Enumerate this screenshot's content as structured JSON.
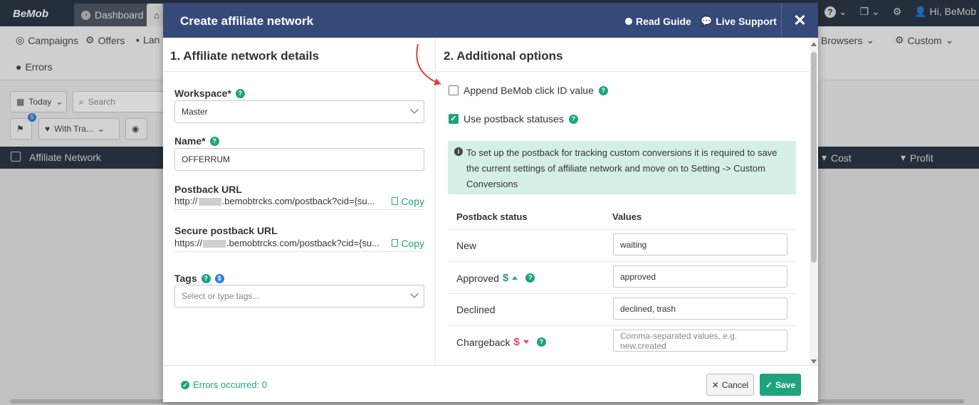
{
  "app": {
    "logo": "BeMob",
    "top_tabs": [
      "Dashboard",
      ""
    ],
    "user_greeting": "Hi, BeMob"
  },
  "nav": {
    "items": [
      "Campaigns",
      "Offers",
      "Lan",
      "Browsers",
      "Custom",
      "Errors"
    ]
  },
  "toolbar": {
    "date_filter": "Today",
    "search_placeholder": "Search",
    "group_filter": "With Tra...",
    "badge_count": "5"
  },
  "table": {
    "headers": [
      "Affiliate Network",
      "Cost",
      "Profit"
    ]
  },
  "modal": {
    "title": "Create affiliate network",
    "read_guide": "Read Guide",
    "live_support": "Live Support",
    "close_symbol": "✕",
    "left": {
      "section_title": "1. Affiliate network details",
      "workspace_label": "Workspace*",
      "workspace_value": "Master",
      "name_label": "Name*",
      "name_value": "OFFERRUM",
      "postback_label": "Postback URL",
      "postback_prefix": "http://",
      "postback_suffix": ".bemobtrcks.com/postback?cid={su...",
      "secure_postback_label": "Secure postback URL",
      "secure_postback_prefix": "https://",
      "secure_postback_suffix": ".bemobtrcks.com/postback?cid={su...",
      "copy_label": "Copy",
      "tags_label": "Tags",
      "tags_placeholder": "Select or type tags..."
    },
    "right": {
      "section_title": "2. Additional options",
      "append_click_id_label": "Append BeMob click ID value",
      "append_click_id_checked": false,
      "use_postback_statuses_label": "Use postback statuses",
      "use_postback_statuses_checked": true,
      "info_text": "To set up the postback for tracking custom conversions it is required to save the current settings of affiliate network and move on to Setting -> Custom Conversions",
      "col_status": "Postback status",
      "col_values": "Values",
      "rows": [
        {
          "status": "New",
          "value": "waiting",
          "placeholder": ""
        },
        {
          "status": "Approved",
          "value": "approved",
          "placeholder": ""
        },
        {
          "status": "Declined",
          "value": "declined, trash",
          "placeholder": ""
        },
        {
          "status": "Chargeback",
          "value": "",
          "placeholder": "Comma-separated values, e.g. new,created"
        }
      ]
    },
    "footer": {
      "errors_text": "Errors occurred: 0",
      "cancel_label": "Cancel",
      "save_label": "Save"
    }
  },
  "colors": {
    "header_bg": "#364a7a",
    "accent_green": "#1fa37f",
    "topbar_bg": "#253140",
    "info_bg": "#d6efe6",
    "danger_red": "#e0485a"
  }
}
